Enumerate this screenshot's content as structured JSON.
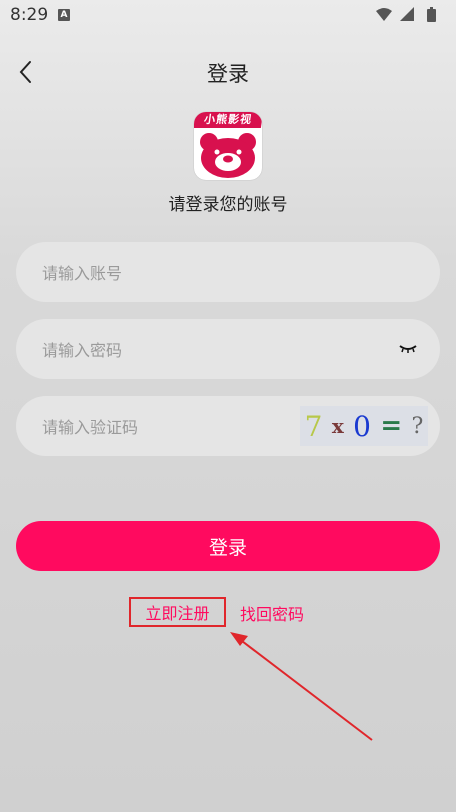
{
  "status_bar": {
    "time": "8:29",
    "app_icon_letter": "A",
    "icons": [
      "wifi-icon",
      "signal-icon",
      "battery-icon"
    ]
  },
  "nav": {
    "back_icon": "chevron-left-icon",
    "title": "登录"
  },
  "logo": {
    "banner_text": "小熊影视",
    "brand_color": "#d8114e"
  },
  "subtitle": "请登录您的账号",
  "form": {
    "account_placeholder": "请输入账号",
    "password_placeholder": "请输入密码",
    "captcha_placeholder": "请输入验证码",
    "captcha_chars": [
      "7",
      "x",
      "0",
      "=",
      "?"
    ],
    "eye_icon": "eye-closed-icon"
  },
  "login_button": {
    "label": "登录",
    "color": "#ff0a5f"
  },
  "links": {
    "register": "立即注册",
    "recover_password": "找回密码"
  },
  "annotation": {
    "color": "#e0262b"
  }
}
